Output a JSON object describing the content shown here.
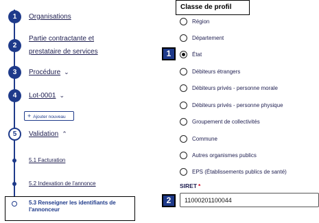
{
  "stepper": {
    "steps": [
      {
        "num": "1",
        "label": "Organisations"
      },
      {
        "num": "2",
        "label_line1": "Partie contractante et",
        "label_line2": "prestataire de services"
      },
      {
        "num": "3",
        "label": "Procédure"
      },
      {
        "num": "4",
        "label": "Lot-0001"
      },
      {
        "num": "5",
        "label": "Validation"
      }
    ],
    "add_button_label": "Ajouter nouveau",
    "substeps": [
      {
        "label": "5.1 Facturation"
      },
      {
        "label": "5.2 Indexation de l'annonce"
      },
      {
        "label": "5.3 Renseigner les identifiants de l'annonceur"
      }
    ]
  },
  "form": {
    "profile_class_title": "Classe de profil",
    "options": [
      {
        "label": "Région",
        "checked": false
      },
      {
        "label": "Département",
        "checked": false
      },
      {
        "label": "État",
        "checked": true
      },
      {
        "label": "Débiteurs étrangers",
        "checked": false
      },
      {
        "label": "Débiteurs privés - personne morale",
        "checked": false
      },
      {
        "label": "Débiteurs privés - personne physique",
        "checked": false
      },
      {
        "label": "Groupement de collectivités",
        "checked": false
      },
      {
        "label": "Commune",
        "checked": false
      },
      {
        "label": "Autres organismes publics",
        "checked": false
      },
      {
        "label": "EPS (Établissements publics de santé)",
        "checked": false
      }
    ],
    "siret_label": "SIRET",
    "siret_required_mark": "*",
    "siret_value": "11000201100044"
  },
  "badges": {
    "badge1": "1",
    "badge2": "2"
  },
  "colors": {
    "primary": "#1e3a8a",
    "required": "#d4001c"
  }
}
